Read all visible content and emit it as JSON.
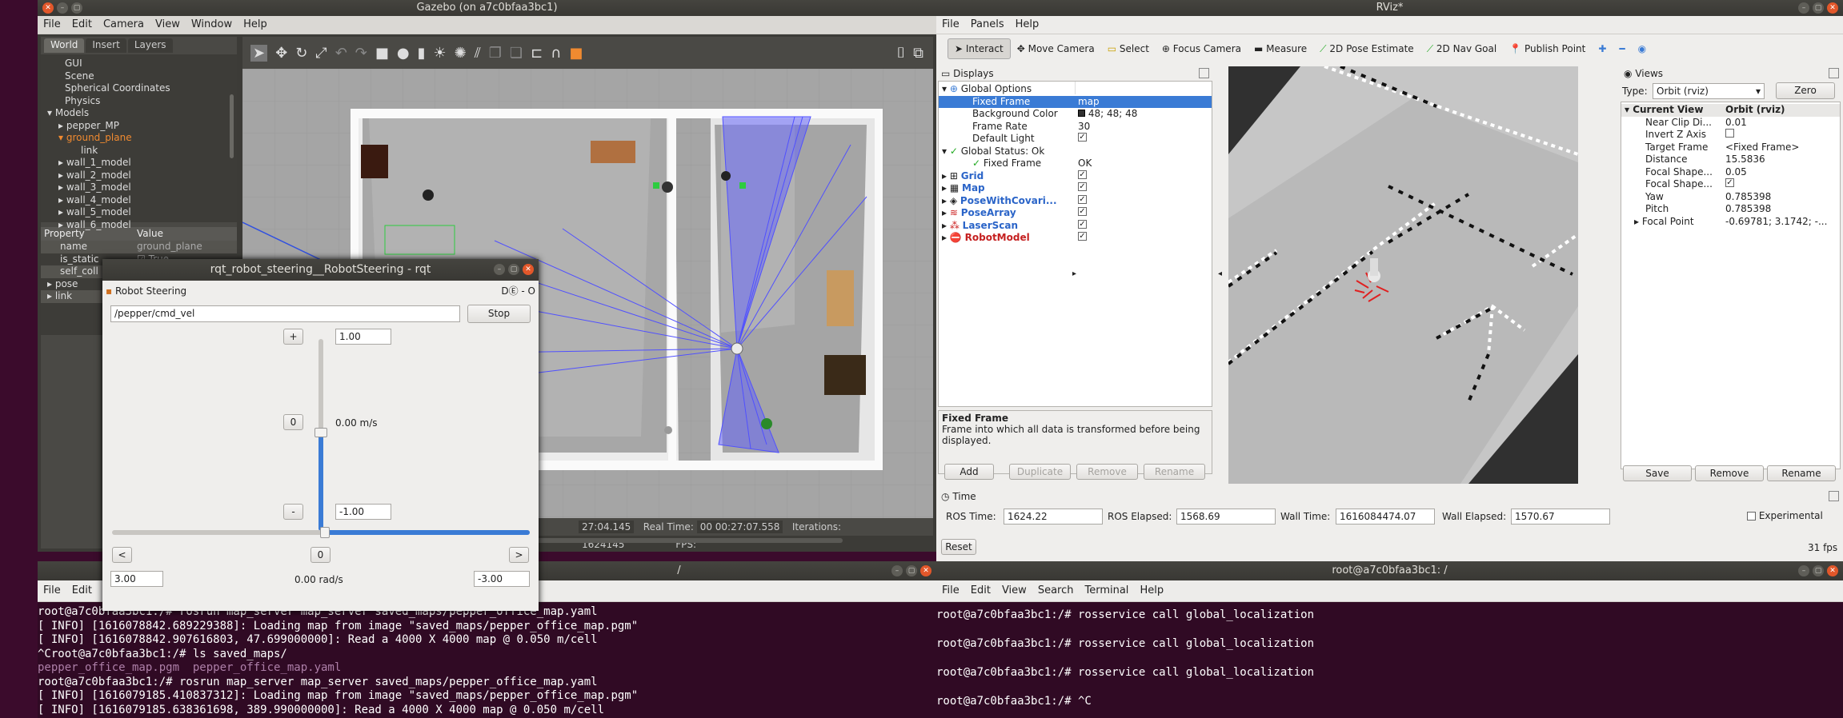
{
  "gazebo": {
    "title": "Gazebo (on a7c0bfaa3bc1)",
    "menu": [
      "File",
      "Edit",
      "Camera",
      "View",
      "Window",
      "Help"
    ],
    "tabs": [
      "World",
      "Insert",
      "Layers"
    ],
    "tree": [
      "GUI",
      "Scene",
      "Spherical Coordinates",
      "Physics",
      "Models",
      "pepper_MP",
      "ground_plane",
      "link",
      "wall_1_model",
      "wall_2_model",
      "wall_3_model",
      "wall_4_model",
      "wall_5_model",
      "wall_6_model"
    ],
    "prop_header": [
      "Property",
      "Value"
    ],
    "props": [
      [
        "name",
        "ground_plane"
      ],
      [
        "is_static",
        "True"
      ],
      [
        "self_coll",
        ""
      ],
      [
        "pose",
        ""
      ],
      [
        "link",
        ""
      ]
    ],
    "status": {
      "sim_time_tail": "27:04.145",
      "real_time_label": "Real Time:",
      "real_time": "00 00:27:07.558",
      "iterations_label": "Iterations:",
      "iterations": "1624145",
      "fps_label": "FPS:"
    }
  },
  "rqt": {
    "title": "rqt_robot_steering__RobotSteering - rqt",
    "plugin": "Robot Steering",
    "plugin_ctrls": "DⒺ - O",
    "topic": "/pepper/cmd_vel",
    "stop": "Stop",
    "plus": "+",
    "minus": "-",
    "zero": "0",
    "max_lin": "1.00",
    "min_lin": "-1.00",
    "lin_val": "0.00 m/s",
    "left": "<",
    "right": ">",
    "ang_zero": "0",
    "max_ang": "3.00",
    "min_ang": "-3.00",
    "ang_val": "0.00 rad/s"
  },
  "rviz": {
    "title": "RViz*",
    "menu": [
      "File",
      "Panels",
      "Help"
    ],
    "tools": [
      "Interact",
      "Move Camera",
      "Select",
      "Focus Camera",
      "Measure",
      "2D Pose Estimate",
      "2D Nav Goal",
      "Publish Point"
    ],
    "displays_title": "Displays",
    "displays": [
      {
        "name": "Global Options",
        "value": ""
      },
      {
        "name": "Fixed Frame",
        "value": "map"
      },
      {
        "name": "Background Color",
        "value": "48; 48; 48"
      },
      {
        "name": "Frame Rate",
        "value": "30"
      },
      {
        "name": "Default Light",
        "value": ""
      },
      {
        "name": "Global Status: Ok",
        "value": ""
      },
      {
        "name": "Fixed Frame",
        "value": "OK"
      },
      {
        "name": "Grid",
        "value": ""
      },
      {
        "name": "Map",
        "value": ""
      },
      {
        "name": "PoseWithCovari...",
        "value": ""
      },
      {
        "name": "PoseArray",
        "value": ""
      },
      {
        "name": "LaserScan",
        "value": ""
      },
      {
        "name": "RobotModel",
        "value": ""
      }
    ],
    "desc_title": "Fixed Frame",
    "desc_text": "Frame into which all data is transformed before being displayed.",
    "disp_buttons": [
      "Add",
      "Duplicate",
      "Remove",
      "Rename"
    ],
    "views_title": "Views",
    "type_label": "Type:",
    "type_value": "Orbit (rviz)",
    "zero": "Zero",
    "view_header": [
      "Current View",
      "Orbit (rviz)"
    ],
    "view_props": [
      [
        "Near Clip Di...",
        "0.01"
      ],
      [
        "Invert Z Axis",
        ""
      ],
      [
        "Target Frame",
        "<Fixed Frame>"
      ],
      [
        "Distance",
        "15.5836"
      ],
      [
        "Focal Shape...",
        "0.05"
      ],
      [
        "Focal Shape...",
        ""
      ],
      [
        "Yaw",
        "0.785398"
      ],
      [
        "Pitch",
        "0.785398"
      ],
      [
        "Focal Point",
        "-0.69781; 3.1742; -..."
      ]
    ],
    "view_buttons": [
      "Save",
      "Remove",
      "Rename"
    ],
    "time_title": "Time",
    "ros_time_label": "ROS Time:",
    "ros_time": "1624.22",
    "ros_elapsed_label": "ROS Elapsed:",
    "ros_elapsed": "1568.69",
    "wall_time_label": "Wall Time:",
    "wall_time": "1616084474.07",
    "wall_elapsed_label": "Wall Elapsed:",
    "wall_elapsed": "1570.67",
    "experimental": "Experimental",
    "reset": "Reset",
    "fps": "31 fps"
  },
  "term_left": {
    "title": "/",
    "menu": [
      "File",
      "Edit"
    ],
    "lines": [
      "root@a7c0bfaa3bc1:/# rosrun map_server map_server saved_maps/pepper_office_map.yaml",
      "[ INFO] [1616078842.689229388]: Loading map from image \"saved_maps/pepper_office_map.pgm\"",
      "[ INFO] [1616078842.907616803, 47.699000000]: Read a 4000 X 4000 map @ 0.050 m/cell",
      "^Croot@a7c0bfaa3bc1:/# ls saved_maps/",
      "pepper_office_map.pgm  pepper_office_map.yaml",
      "root@a7c0bfaa3bc1:/# rosrun map_server map_server saved_maps/pepper_office_map.yaml",
      "[ INFO] [1616079185.410837312]: Loading map from image \"saved_maps/pepper_office_map.pgm\"",
      "[ INFO] [1616079185.638361698, 389.990000000]: Read a 4000 X 4000 map @ 0.050 m/cell"
    ]
  },
  "term_right": {
    "title": "root@a7c0bfaa3bc1: /",
    "menu": [
      "File",
      "Edit",
      "View",
      "Search",
      "Terminal",
      "Help"
    ],
    "lines": [
      "root@a7c0bfaa3bc1:/# rosservice call global_localization",
      "",
      "root@a7c0bfaa3bc1:/# rosservice call global_localization",
      "",
      "root@a7c0bfaa3bc1:/# rosservice call global_localization",
      "",
      "root@a7c0bfaa3bc1:/# ^C"
    ]
  }
}
